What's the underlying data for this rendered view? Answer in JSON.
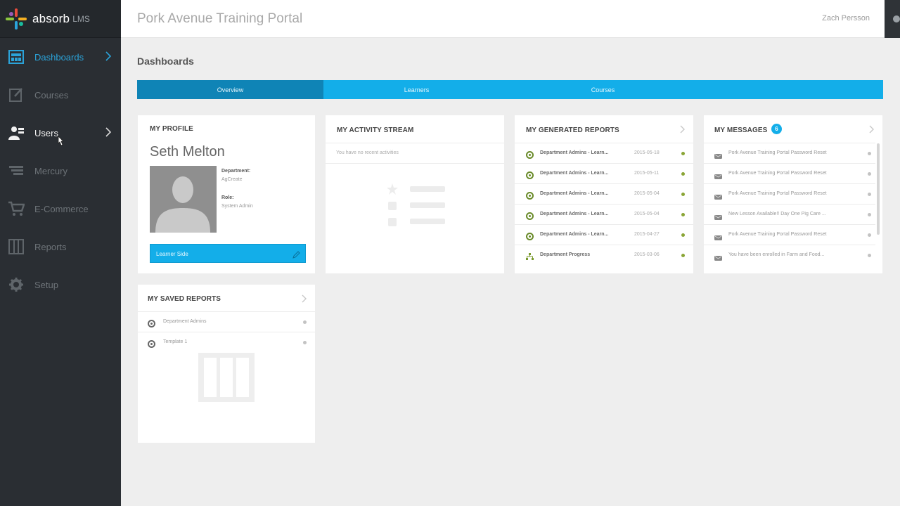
{
  "app": {
    "logo_text": "absorb",
    "logo_sub": "LMS",
    "portal_title": "Pork Avenue Training Portal",
    "user_name": "Zach Persson"
  },
  "sidebar": {
    "items": [
      {
        "label": "Dashboards",
        "icon": "dashboard-icon"
      },
      {
        "label": "Courses",
        "icon": "courses-icon"
      },
      {
        "label": "Users",
        "icon": "users-icon"
      },
      {
        "label": "Mercury",
        "icon": "mercury-icon"
      },
      {
        "label": "E-Commerce",
        "icon": "cart-icon"
      },
      {
        "label": "Reports",
        "icon": "reports-icon"
      },
      {
        "label": "Setup",
        "icon": "gear-icon"
      }
    ]
  },
  "main": {
    "heading": "Dashboards",
    "tabs": [
      {
        "label": "Overview"
      },
      {
        "label": "Learners"
      },
      {
        "label": "Courses"
      }
    ]
  },
  "profile": {
    "title": "MY PROFILE",
    "name": "Seth Melton",
    "department_label": "Department:",
    "department_value": "AgCreate",
    "role_label": "Role:",
    "role_value": "System Admin",
    "button_label": "Learner Side"
  },
  "activity": {
    "title": "MY ACTIVITY STREAM",
    "empty_text": "You have no recent activities"
  },
  "generated_reports": {
    "title": "MY GENERATED REPORTS",
    "rows": [
      {
        "label": "Department Admins - Learn...",
        "date": "2015-05-18"
      },
      {
        "label": "Department Admins - Learn...",
        "date": "2015-05-11"
      },
      {
        "label": "Department Admins - Learn...",
        "date": "2015-05-04"
      },
      {
        "label": "Department Admins - Learn...",
        "date": "2015-05-04"
      },
      {
        "label": "Department Admins - Learn...",
        "date": "2015-04-27"
      },
      {
        "label": "Department Progress",
        "date": "2015-03-06"
      }
    ]
  },
  "messages": {
    "title": "MY MESSAGES",
    "count": "6",
    "rows": [
      {
        "label": "Pork Avenue Training Portal Password Reset"
      },
      {
        "label": "Pork Avenue Training Portal Password Reset"
      },
      {
        "label": "Pork Avenue Training Portal Password Reset"
      },
      {
        "label": "New Lesson Available!! Day One Pig Care ..."
      },
      {
        "label": "Pork Avenue Training Portal Password Reset"
      },
      {
        "label": "You have been enrolled in Farm and Food..."
      }
    ]
  },
  "saved_reports": {
    "title": "MY SAVED REPORTS",
    "rows": [
      {
        "label": "Department Admins"
      },
      {
        "label": "Template 1"
      }
    ]
  },
  "colors": {
    "accent": "#13aee9",
    "accent_dark": "#0f84b6",
    "sidebar_bg": "#2a2e33",
    "active_nav": "#2ba3d9"
  }
}
